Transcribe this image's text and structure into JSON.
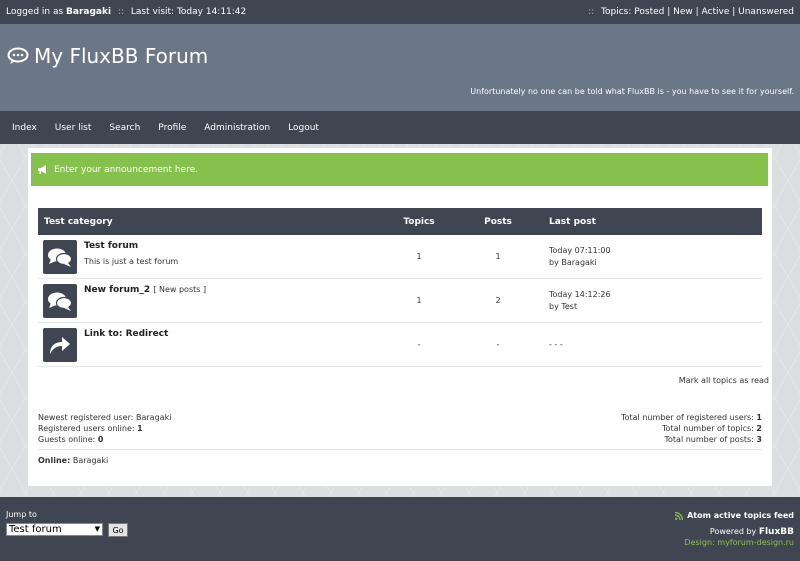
{
  "topbar": {
    "logged_in_prefix": "Logged in as",
    "username": "Baragaki",
    "last_visit": "Last visit: Today 14:11:42",
    "topics_prefix": "Topics:",
    "links": [
      "Posted",
      "New",
      "Active",
      "Unanswered"
    ]
  },
  "header": {
    "title": "My FluxBB Forum",
    "tagline": "Unfortunately no one can be told what FluxBB is - you have to see it for yourself."
  },
  "nav": [
    "Index",
    "User list",
    "Search",
    "Profile",
    "Administration",
    "Logout"
  ],
  "announcement": "Enter your announcement here.",
  "category": {
    "name": "Test category",
    "col_topics": "Topics",
    "col_posts": "Posts",
    "col_last": "Last post",
    "forums": [
      {
        "title": "Test forum",
        "new_posts": "",
        "desc": "This is just a test forum",
        "topics": "1",
        "posts": "1",
        "last_time": "Today 07:11:00",
        "last_by": "by Baragaki"
      },
      {
        "title": "New forum_2",
        "new_posts": "[ New posts ]",
        "desc": "",
        "topics": "1",
        "posts": "2",
        "last_time": "Today 14:12:26",
        "last_by": "by Test"
      },
      {
        "title": "Link to: Redirect",
        "new_posts": "",
        "desc": "",
        "topics": "-",
        "posts": "-",
        "last_time": "- - -",
        "last_by": ""
      }
    ]
  },
  "mark_all": "Mark all topics as read",
  "stats": {
    "newest_label": "Newest registered user:",
    "newest_user": "Baragaki",
    "reg_online_label": "Registered users online:",
    "reg_online": "1",
    "guests_label": "Guests online:",
    "guests": "0",
    "total_users_label": "Total number of registered users:",
    "total_users": "1",
    "total_topics_label": "Total number of topics:",
    "total_topics": "2",
    "total_posts_label": "Total number of posts:",
    "total_posts": "3",
    "online_label": "Online:",
    "online_users": "Baragaki"
  },
  "footer": {
    "jump_label": "Jump to",
    "jump_selected": "Test forum",
    "go": "Go",
    "feed": "Atom active topics feed",
    "powered_prefix": "Powered by",
    "powered_name": "FluxBB",
    "design": "Design: myforum-design.ru"
  },
  "colors": {
    "dark": "#3f4551",
    "header": "#6b7686",
    "accent_green": "#86c04d"
  }
}
